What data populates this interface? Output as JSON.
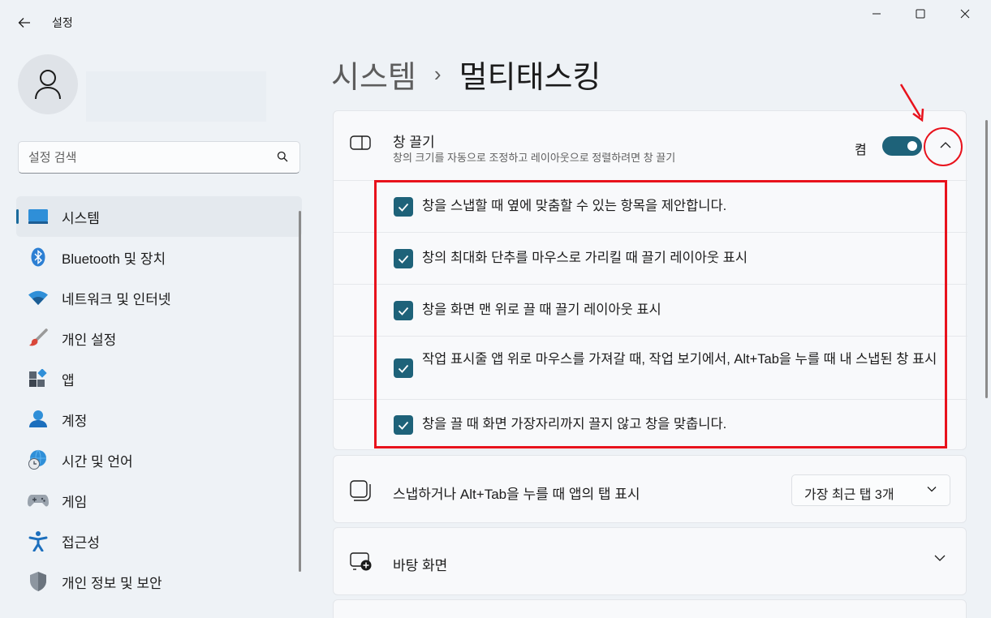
{
  "window": {
    "title": "설정"
  },
  "sidebar": {
    "search_placeholder": "설정 검색",
    "items": [
      {
        "label": "시스템",
        "icon": "system-icon",
        "active": true
      },
      {
        "label": "Bluetooth 및 장치",
        "icon": "bluetooth-icon"
      },
      {
        "label": "네트워크 및 인터넷",
        "icon": "wifi-icon"
      },
      {
        "label": "개인 설정",
        "icon": "paintbrush-icon"
      },
      {
        "label": "앱",
        "icon": "apps-icon"
      },
      {
        "label": "계정",
        "icon": "account-icon"
      },
      {
        "label": "시간 및 언어",
        "icon": "globe-clock-icon"
      },
      {
        "label": "게임",
        "icon": "gamepad-icon"
      },
      {
        "label": "접근성",
        "icon": "accessibility-icon"
      },
      {
        "label": "개인 정보 및 보안",
        "icon": "shield-icon"
      }
    ]
  },
  "breadcrumb": {
    "parent": "시스템",
    "separator": "›",
    "current": "멀티태스킹"
  },
  "snap": {
    "title": "창 끌기",
    "description": "창의 크기를 자동으로 조정하고 레이아웃으로 정렬하려면 창 끌기",
    "toggle_label": "켬",
    "toggle_on": true,
    "options": [
      {
        "label": "창을 스냅할 때 옆에 맞춤할 수 있는 항목을 제안합니다.",
        "checked": true
      },
      {
        "label": "창의 최대화 단추를 마우스로 가리킬 때 끌기 레이아웃 표시",
        "checked": true
      },
      {
        "label": "창을 화면 맨 위로 끌 때 끌기 레이아웃 표시",
        "checked": true
      },
      {
        "label": "작업 표시줄 앱 위로 마우스를 가져갈 때, 작업 보기에서, Alt+Tab을 누를 때 내 스냅된 창 표시",
        "checked": true
      },
      {
        "label": "창을 끌 때 화면 가장자리까지 끌지 않고 창을 맞춥니다.",
        "checked": true
      }
    ]
  },
  "alttab": {
    "label": "스냅하거나 Alt+Tab을 누를 때 앱의 탭 표시",
    "dropdown_value": "가장 최근 탭 3개"
  },
  "desktops": {
    "label": "바탕 화면"
  },
  "colors": {
    "accent": "#1e6279",
    "annotation": "#e8121c"
  }
}
